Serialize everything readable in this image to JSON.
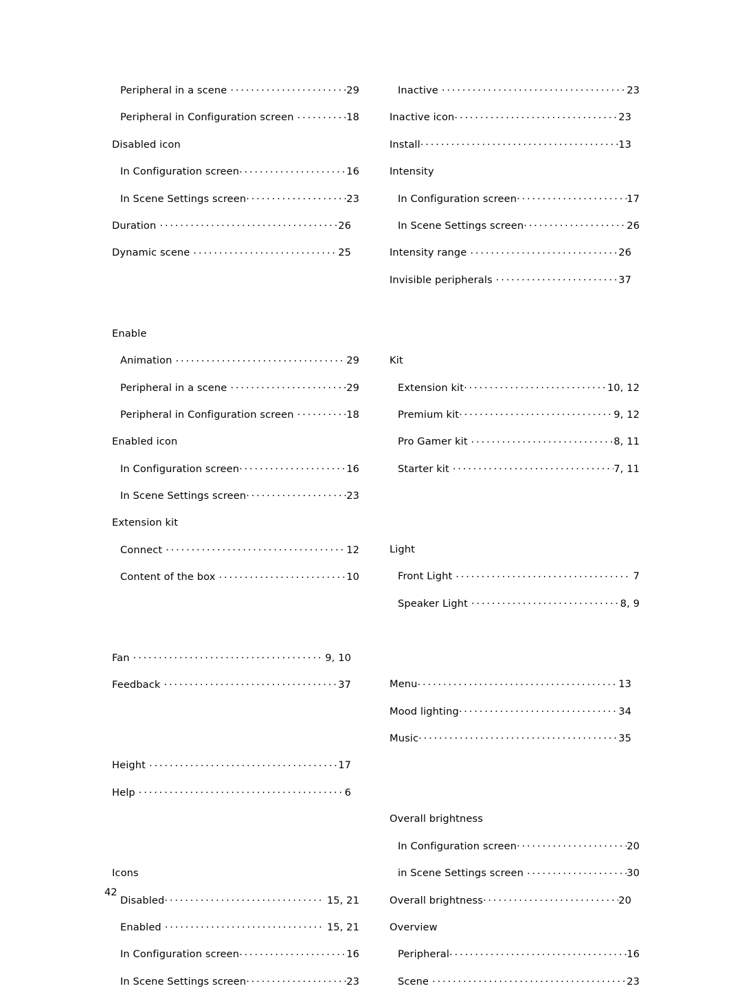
{
  "document": {
    "page_number": "42",
    "type": "index"
  },
  "columns": {
    "left": [
      {
        "label": "Peripheral in a scene",
        "pages": "29",
        "level": 2,
        "space_before_leader": true
      },
      {
        "label": "Peripheral in Configuration screen",
        "pages": "18",
        "level": 2,
        "space_before_leader": true
      },
      {
        "label": "Disabled icon",
        "pages": "",
        "level": 1,
        "heading": true
      },
      {
        "label": "In Configuration screen",
        "pages": "16",
        "level": 2,
        "space_before_leader": false
      },
      {
        "label": "In Scene Settings screen",
        "pages": "23",
        "level": 2,
        "space_before_leader": false
      },
      {
        "label": "Duration",
        "pages": "26",
        "level": 1,
        "space_before_leader": true
      },
      {
        "label": "Dynamic scene",
        "pages": "25",
        "level": 1,
        "space_before_leader": true
      },
      {
        "label": "",
        "pages": "",
        "level": 1,
        "gap": "large"
      },
      {
        "label": "Enable",
        "pages": "",
        "level": 1,
        "heading": true
      },
      {
        "label": "Animation",
        "pages": "29",
        "level": 2,
        "space_before_leader": true
      },
      {
        "label": "Peripheral in a scene",
        "pages": "29",
        "level": 2,
        "space_before_leader": true
      },
      {
        "label": "Peripheral in Configuration screen",
        "pages": "18",
        "level": 2,
        "space_before_leader": true
      },
      {
        "label": "Enabled icon",
        "pages": "",
        "level": 1,
        "heading": true
      },
      {
        "label": "In Configuration screen",
        "pages": "16",
        "level": 2,
        "space_before_leader": false
      },
      {
        "label": "In Scene Settings screen",
        "pages": "23",
        "level": 2,
        "space_before_leader": false
      },
      {
        "label": "Extension kit",
        "pages": "",
        "level": 1,
        "heading": true
      },
      {
        "label": "Connect",
        "pages": "12",
        "level": 2,
        "space_before_leader": true
      },
      {
        "label": "Content of the box",
        "pages": "10",
        "level": 2,
        "space_before_leader": true
      },
      {
        "label": "",
        "pages": "",
        "level": 1,
        "gap": "large"
      },
      {
        "label": "Fan",
        "pages": "9, 10",
        "level": 1,
        "space_before_leader": true,
        "space_after_leader": true
      },
      {
        "label": "Feedback",
        "pages": "37",
        "level": 1,
        "space_before_leader": true
      },
      {
        "label": "",
        "pages": "",
        "level": 1,
        "gap": "large"
      },
      {
        "label": "Height",
        "pages": "17",
        "level": 1,
        "space_before_leader": true
      },
      {
        "label": "Help",
        "pages": "6",
        "level": 1,
        "space_before_leader": true,
        "space_after_leader": true
      },
      {
        "label": "",
        "pages": "",
        "level": 1,
        "gap": "large"
      },
      {
        "label": "Icons",
        "pages": "",
        "level": 1,
        "heading": true
      },
      {
        "label": "Disabled",
        "pages": "15, 21",
        "level": 2,
        "space_before_leader": false,
        "space_after_leader": true
      },
      {
        "label": "Enabled",
        "pages": "15, 21",
        "level": 2,
        "space_before_leader": true,
        "space_after_leader": true
      },
      {
        "label": "In Configuration screen",
        "pages": "16",
        "level": 2,
        "space_before_leader": false
      },
      {
        "label": "In Scene Settings screen",
        "pages": "23",
        "level": 2,
        "space_before_leader": false
      }
    ],
    "right": [
      {
        "label": "Inactive",
        "pages": "23",
        "level": 2,
        "space_before_leader": true
      },
      {
        "label": "Inactive icon",
        "pages": "23",
        "level": 1,
        "space_before_leader": false
      },
      {
        "label": "Install",
        "pages": "13",
        "level": 1,
        "space_before_leader": false
      },
      {
        "label": "Intensity",
        "pages": "",
        "level": 1,
        "heading": true
      },
      {
        "label": "In Configuration screen",
        "pages": "17",
        "level": 2,
        "space_before_leader": false
      },
      {
        "label": "In Scene Settings screen",
        "pages": "26",
        "level": 2,
        "space_before_leader": false
      },
      {
        "label": "Intensity range",
        "pages": "26",
        "level": 1,
        "space_before_leader": true
      },
      {
        "label": "Invisible peripherals",
        "pages": "37",
        "level": 1,
        "space_before_leader": true
      },
      {
        "label": "",
        "pages": "",
        "level": 1,
        "gap": "large"
      },
      {
        "label": "Kit",
        "pages": "",
        "level": 1,
        "heading": true
      },
      {
        "label": "Extension kit",
        "pages": "10, 12",
        "level": 2,
        "space_before_leader": false,
        "space_after_leader": true
      },
      {
        "label": "Premium kit",
        "pages": "9, 12",
        "level": 2,
        "space_before_leader": false
      },
      {
        "label": "Pro Gamer kit",
        "pages": "8, 11",
        "level": 2,
        "space_before_leader": true
      },
      {
        "label": "Starter kit",
        "pages": "7, 11",
        "level": 2,
        "space_before_leader": true
      },
      {
        "label": "",
        "pages": "",
        "level": 1,
        "gap": "large"
      },
      {
        "label": "Light",
        "pages": "",
        "level": 1,
        "heading": true
      },
      {
        "label": "Front Light",
        "pages": "7",
        "level": 2,
        "space_before_leader": true,
        "space_after_leader": true
      },
      {
        "label": "Speaker Light",
        "pages": "8, 9",
        "level": 2,
        "space_before_leader": true
      },
      {
        "label": "",
        "pages": "",
        "level": 1,
        "gap": "large"
      },
      {
        "label": "Menu",
        "pages": "13",
        "level": 1,
        "space_before_leader": false
      },
      {
        "label": "Mood lighting",
        "pages": "34",
        "level": 1,
        "space_before_leader": false
      },
      {
        "label": "Music",
        "pages": "35",
        "level": 1,
        "space_before_leader": false
      },
      {
        "label": "",
        "pages": "",
        "level": 1,
        "gap": "large"
      },
      {
        "label": "Overall brightness",
        "pages": "",
        "level": 1,
        "heading": true
      },
      {
        "label": "In Configuration screen",
        "pages": "20",
        "level": 2,
        "space_before_leader": false
      },
      {
        "label": "in Scene Settings screen",
        "pages": "30",
        "level": 2,
        "space_before_leader": true
      },
      {
        "label": "Overall brightness",
        "pages": "20",
        "level": 1,
        "space_before_leader": false
      },
      {
        "label": "Overview",
        "pages": "",
        "level": 1,
        "heading": true
      },
      {
        "label": "Peripheral",
        "pages": "16",
        "level": 2,
        "space_before_leader": false
      },
      {
        "label": "Scene",
        "pages": "23",
        "level": 2,
        "space_before_leader": true
      }
    ]
  }
}
